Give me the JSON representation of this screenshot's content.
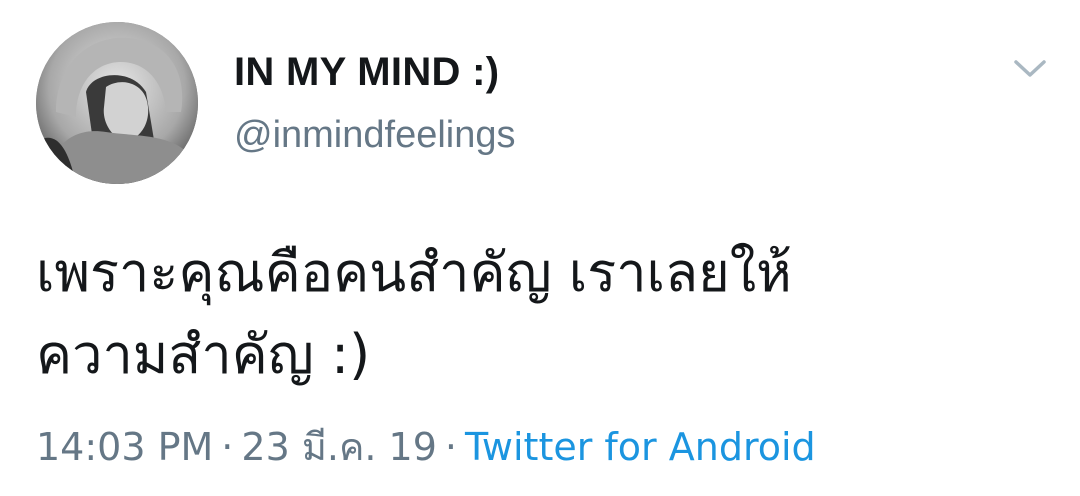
{
  "tweet": {
    "display_name": "IN MY MIND :)",
    "handle": "@inmindfeelings",
    "text_line1": "เพราะคุณคือคนสำคัญ เราเลยให้",
    "text_line2": "ความสำคัญ :)",
    "time": "14:03 PM",
    "separator": "·",
    "date": "23 มี.ค. 19",
    "source": "Twitter for Android"
  },
  "icons": {
    "menu": "chevron-down-icon",
    "avatar": "profile-photo"
  },
  "colors": {
    "primary_text": "#14171a",
    "secondary_text": "#657786",
    "link": "#1b95e0",
    "caret": "#aab8c2"
  }
}
